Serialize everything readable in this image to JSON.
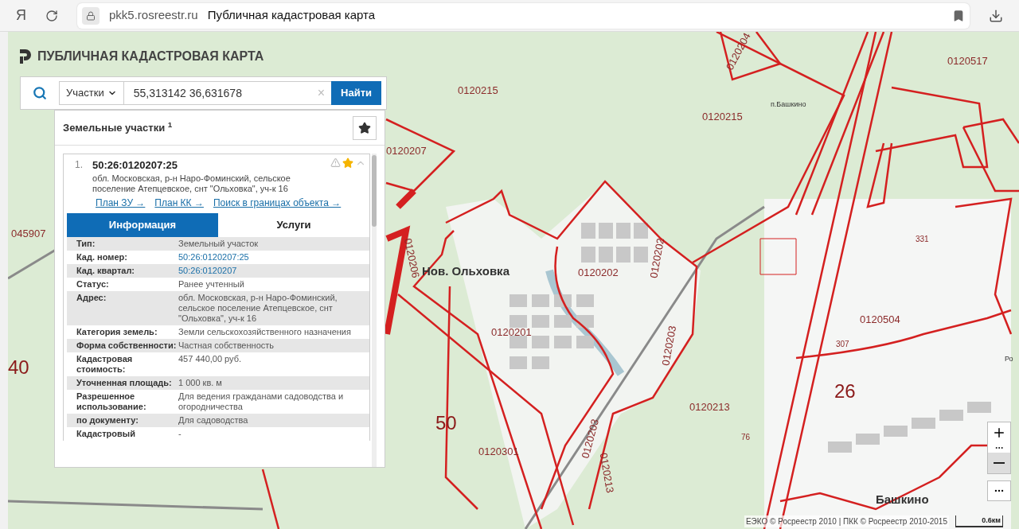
{
  "browser": {
    "logo": "Я",
    "url": "pkk5.rosreestr.ru",
    "page_title": "Публичная кадастровая карта"
  },
  "app_title": "ПУБЛИЧНАЯ КАДАСТРОВАЯ КАРТА",
  "search": {
    "category": "Участки",
    "value": "55,313142 36,631678",
    "clear": "×",
    "button": "Найти"
  },
  "results": {
    "heading": "Земельные участки",
    "count": "1",
    "items": [
      {
        "number": "1.",
        "cadastral_number": "50:26:0120207:25",
        "address": "обл. Московская, р-н Наро-Фоминский, сельское поселение Атепцевское, снт \"Ольховка\", уч-к 16",
        "favorite": true,
        "expanded": true,
        "links": [
          "План ЗУ →",
          "План КК →",
          "Поиск в границах объекта →"
        ]
      }
    ]
  },
  "tabs": [
    {
      "label": "Информация",
      "selected": true
    },
    {
      "label": "Услуги",
      "selected": false
    }
  ],
  "info_rows": [
    {
      "label": "Тип:",
      "value": "Земельный участок",
      "kind": "text"
    },
    {
      "label": "Кад. номер:",
      "value": "50:26:0120207:25",
      "kind": "link"
    },
    {
      "label": "Кад. квартал:",
      "value": "50:26:0120207",
      "kind": "link"
    },
    {
      "label": "Статус:",
      "value": "Ранее учтенный",
      "kind": "text"
    },
    {
      "label": "Адрес:",
      "value": "обл. Московская, р-н Наро-Фоминский, сельское поселение Атепцевское, снт \"Ольховка\", уч-к 16",
      "kind": "text"
    },
    {
      "label": "Категория земель:",
      "value": "Земли сельскохозяйственного назначения",
      "kind": "text"
    },
    {
      "label": "Форма собственности:",
      "value": "Частная собственность",
      "kind": "text"
    },
    {
      "label": "Кадастровая стоимость:",
      "value": "457 440,00 руб.",
      "kind": "text"
    },
    {
      "label": "Уточненная площадь:",
      "value": "1 000 кв. м",
      "kind": "text"
    },
    {
      "label": "Разрешенное использование:",
      "value": "Для ведения гражданами садоводства и огородничества",
      "kind": "text"
    },
    {
      "label": "по документу:",
      "value": "Для садоводства",
      "kind": "text"
    },
    {
      "label": "Кадастровый",
      "value": "-",
      "kind": "text"
    }
  ],
  "map_labels": [
    {
      "text": "0120215",
      "kind": "quarter"
    },
    {
      "text": "0120215",
      "kind": "quarter"
    },
    {
      "text": "0120207",
      "kind": "quarter"
    },
    {
      "text": "0120204",
      "kind": "quarter"
    },
    {
      "text": "0120517",
      "kind": "quarter"
    },
    {
      "text": "п.Башкино",
      "kind": "place"
    },
    {
      "text": "045907",
      "kind": "quarter"
    },
    {
      "text": "Нов. Ольховка",
      "kind": "settlement"
    },
    {
      "text": "0120206",
      "kind": "quarter"
    },
    {
      "text": "0120202",
      "kind": "quarter"
    },
    {
      "text": "0120202",
      "kind": "quarter"
    },
    {
      "text": "331",
      "kind": "parcel"
    },
    {
      "text": "0120201",
      "kind": "quarter"
    },
    {
      "text": "0120203",
      "kind": "quarter"
    },
    {
      "text": "0120504",
      "kind": "quarter"
    },
    {
      "text": "307",
      "kind": "parcel"
    },
    {
      "text": "40",
      "kind": "district"
    },
    {
      "text": "26",
      "kind": "district"
    },
    {
      "text": "0120213",
      "kind": "quarter"
    },
    {
      "text": "50",
      "kind": "district"
    },
    {
      "text": "0120203",
      "kind": "quarter"
    },
    {
      "text": "0120301",
      "kind": "quarter"
    },
    {
      "text": "0120213",
      "kind": "quarter"
    },
    {
      "text": "76",
      "kind": "parcel"
    },
    {
      "text": "Ро",
      "kind": "place"
    },
    {
      "text": "Башкино",
      "kind": "settlement"
    }
  ],
  "scale": "0.6км",
  "attribution": "ЕЭКО © Росреестр 2010 | ПКК © Росреестр 2010-2015"
}
